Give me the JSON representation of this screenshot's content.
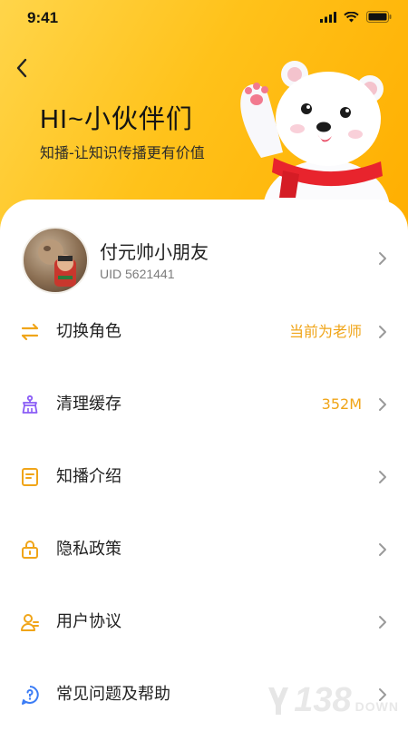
{
  "status_bar": {
    "time": "9:41"
  },
  "header": {
    "greeting": "HI~小伙伴们",
    "slogan": "知播-让知识传播更有价值"
  },
  "profile": {
    "name": "付元帅小朋友",
    "uid": "UID 5621441"
  },
  "menu": [
    {
      "label": "切换角色",
      "value": "当前为老师",
      "icon": "swap-icon"
    },
    {
      "label": "清理缓存",
      "value": "352M",
      "icon": "broom-icon"
    },
    {
      "label": "知播介绍",
      "value": "",
      "icon": "document-icon"
    },
    {
      "label": "隐私政策",
      "value": "",
      "icon": "lock-icon"
    },
    {
      "label": "用户协议",
      "value": "",
      "icon": "user-agreement-icon"
    },
    {
      "label": "常见问题及帮助",
      "value": "",
      "icon": "help-icon"
    }
  ],
  "watermark": {
    "number": "138",
    "suffix": "DOWN"
  },
  "colors": {
    "accent": "#f0a519",
    "header_start": "#ffd54a",
    "header_end": "#ffae00"
  }
}
